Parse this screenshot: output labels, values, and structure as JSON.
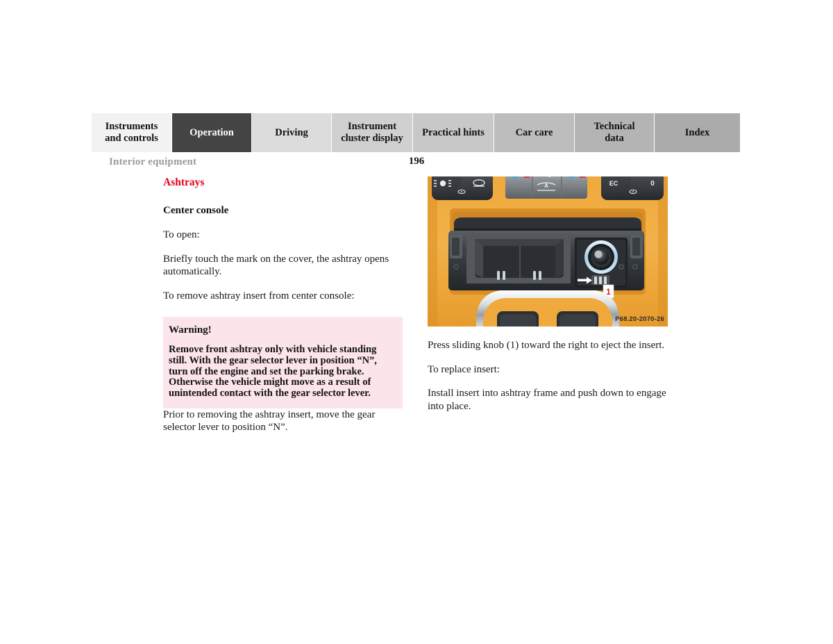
{
  "document": {
    "running_head": "Interior equipment",
    "page_number": "196"
  },
  "tabs": [
    {
      "label": "Instruments\nand controls",
      "active": false,
      "tone": "t0"
    },
    {
      "label": "Operation",
      "active": true,
      "tone": "t1"
    },
    {
      "label": "Driving",
      "active": false,
      "tone": "t2"
    },
    {
      "label": "Instrument\ncluster display",
      "active": false,
      "tone": "t3"
    },
    {
      "label": "Practical hints",
      "active": false,
      "tone": "t4"
    },
    {
      "label": "Car care",
      "active": false,
      "tone": "t5"
    },
    {
      "label": "Technical\ndata",
      "active": false,
      "tone": "t6"
    },
    {
      "label": "Index",
      "active": false,
      "tone": "t7"
    }
  ],
  "left_column": {
    "section_title": "Ashtrays",
    "subhead": "Center console",
    "paragraphs": [
      "To open:",
      "Briefly touch the mark on the cover, the ashtray opens automatically.",
      "To remove ashtray insert from center console:"
    ],
    "warning": {
      "title": "Warning!",
      "text": "Remove front ashtray only with vehicle standing still. With the gear selector lever in position “N”, turn off the engine and set the parking brake. Otherwise the vehicle might move as a result of unintended contact with the gear selector lever."
    },
    "after_warning": "Prior to removing the ashtray insert, move the gear selector lever to position “N”."
  },
  "right_column": {
    "figure": {
      "alt": "Center console ashtray open, with sliding knob callout",
      "callout_label": "1",
      "caption_code": "P68.20-2070-26",
      "console_trim_color": "#f0a93a",
      "button_labels": {
        "climate_left": "EC",
        "climate_right": "0",
        "auto": "A"
      }
    },
    "paragraphs": [
      "Press sliding knob (1) toward the right to eject the insert.",
      "To replace insert:",
      "Install insert into ashtray frame and push down to engage into place."
    ]
  },
  "colors": {
    "accent_red": "#e2001a",
    "warning_bg": "#fbe4ea",
    "active_tab_bg": "#444444",
    "running_head": "#9b9b9b"
  }
}
